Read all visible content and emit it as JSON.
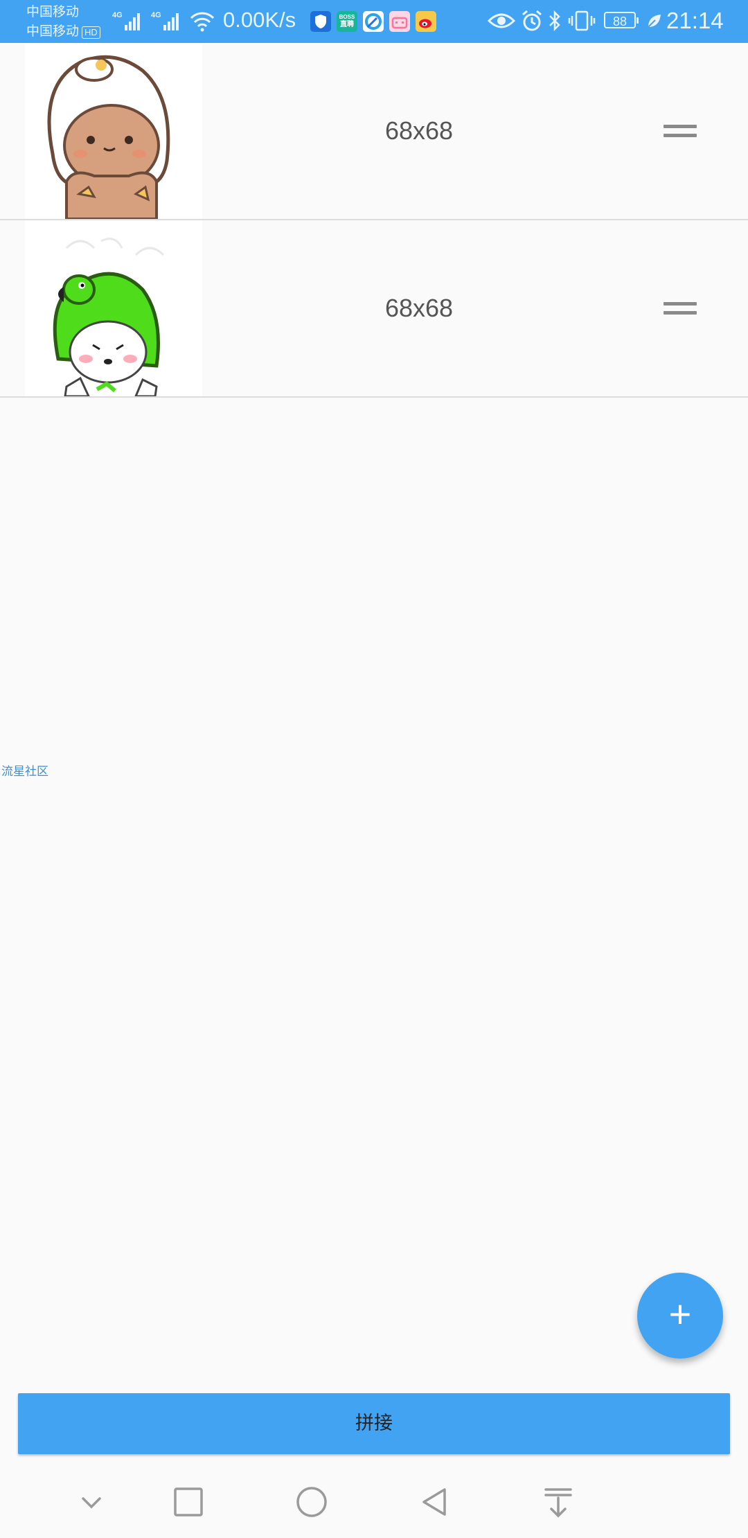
{
  "status_bar": {
    "carrier_1": "中国移动",
    "carrier_2": "中国移动",
    "hd_badge": "HD",
    "network_type": "4G",
    "net_speed": "0.00K/s",
    "app_icons": [
      "shield-app-icon",
      "boss-app-icon",
      "browser-app-icon",
      "bilibili-app-icon",
      "weibo-app-icon"
    ],
    "boss_label_1": "BOSS",
    "boss_label_2": "直聘",
    "battery": "88",
    "time": "21:14"
  },
  "image_list": {
    "items": [
      {
        "size_label": "68x68",
        "thumbnail": "brown-bear-sticker"
      },
      {
        "size_label": "68x68",
        "thumbnail": "green-hood-panda-sticker"
      }
    ]
  },
  "watermark": "流星社区",
  "fab": {
    "icon": "plus-icon",
    "label": "+"
  },
  "join_button": {
    "label": "拼接"
  },
  "nav_bar": {
    "buttons": [
      "hide-nav-icon",
      "recents-icon",
      "home-icon",
      "back-icon",
      "notification-pull-icon"
    ]
  },
  "colors": {
    "accent": "#42a3f3",
    "background": "#fafafa",
    "divider": "#dcdcdc",
    "label_text": "#555555"
  }
}
